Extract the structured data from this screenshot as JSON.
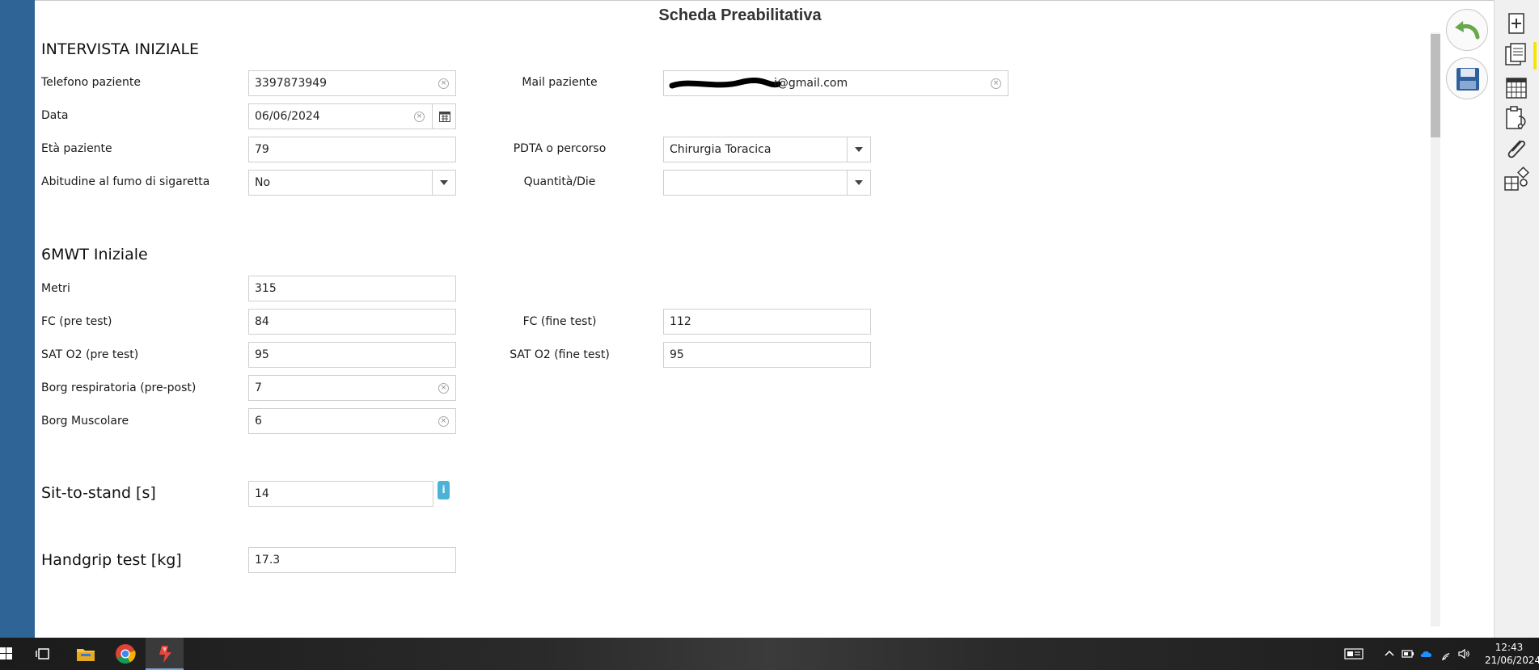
{
  "form": {
    "title": "Scheda Preabilitativa"
  },
  "sections": {
    "intervista": "INTERVISTA INIZIALE",
    "mwt": "6MWT Iniziale",
    "sit_to_stand": "Sit-to-stand [s]",
    "handgrip": "Handgrip test [kg]"
  },
  "intervista": {
    "telefono": {
      "label": "Telefono paziente",
      "value": "3397873949"
    },
    "mail": {
      "label": "Mail paziente",
      "value": "i@gmail.com"
    },
    "data": {
      "label": "Data",
      "value": "06/06/2024"
    },
    "eta": {
      "label": "Età paziente",
      "value": "79"
    },
    "pdta": {
      "label": "PDTA o percorso",
      "value": "Chirurgia Toracica"
    },
    "fumo": {
      "label": "Abitudine al fumo di sigaretta",
      "value": "No"
    },
    "quantita": {
      "label": "Quantità/Die",
      "value": ""
    }
  },
  "mwt": {
    "metri": {
      "label": "Metri",
      "value": "315"
    },
    "fc_pre": {
      "label": "FC (pre test)",
      "value": "84"
    },
    "fc_fine": {
      "label": "FC (fine test)",
      "value": "112"
    },
    "sat_pre": {
      "label": "SAT O2 (pre test)",
      "value": "95"
    },
    "sat_fine": {
      "label": "SAT O2 (fine test)",
      "value": "95"
    },
    "borg_resp": {
      "label": "Borg respiratoria (pre-post)",
      "value": "7"
    },
    "borg_musc": {
      "label": "Borg Muscolare",
      "value": "6"
    }
  },
  "sit_to_stand": {
    "value": "14",
    "info_glyph": "i"
  },
  "handgrip": {
    "value": "17.3"
  },
  "taskbar": {
    "time": "12:43",
    "date": "21/06/2024"
  },
  "icons": {
    "back": "undo-arrow-icon",
    "save": "floppy-disk-icon",
    "sidebar": [
      "add-page-icon",
      "documents-icon",
      "calendar-icon",
      "clipboard-stethoscope-icon",
      "paperclip-icon",
      "grid-shapes-icon"
    ]
  },
  "colors": {
    "left_strip": "#2f6596",
    "info_button": "#4cb3d6",
    "sidebar_highlight": "#f5e500",
    "back_arrow": "#6aa84f",
    "save_icon": "#2f5f9e"
  }
}
